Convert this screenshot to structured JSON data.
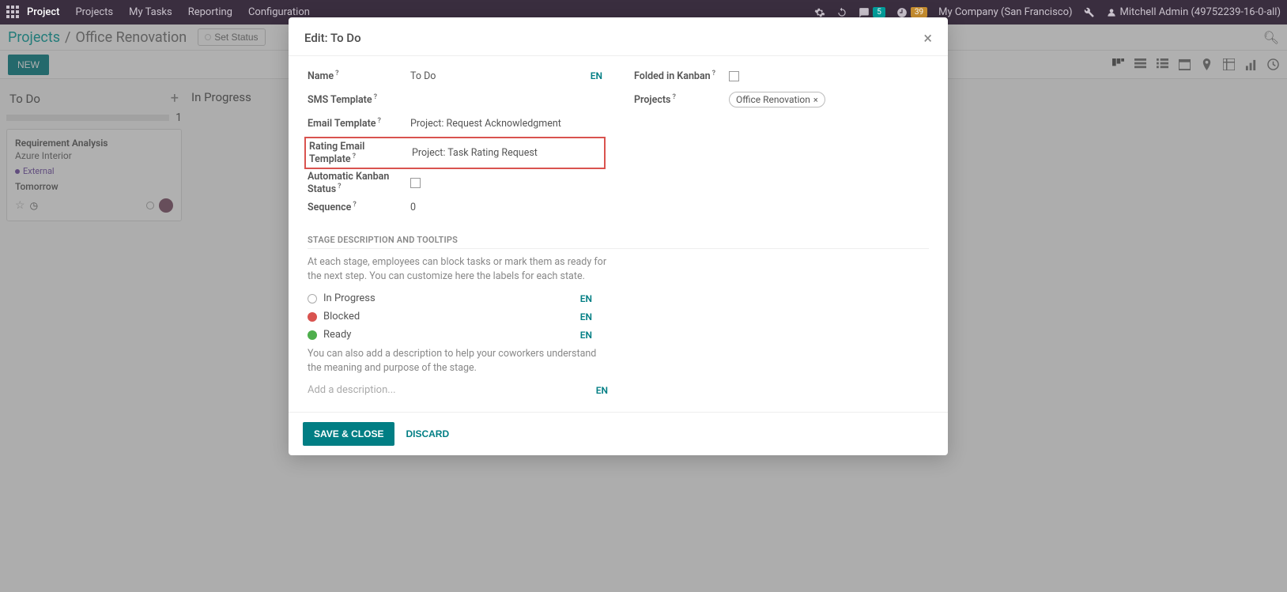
{
  "navbar": {
    "brand": "Project",
    "links": [
      "Projects",
      "My Tasks",
      "Reporting",
      "Configuration"
    ],
    "msg_count": "5",
    "clock_count": "39",
    "company": "My Company (San Francisco)",
    "user": "Mitchell Admin (49752239-16-0-all)"
  },
  "breadcrumb": {
    "root": "Projects",
    "current": "Office Renovation",
    "status_btn": "Set Status"
  },
  "toolbar": {
    "new": "NEW"
  },
  "kanban": {
    "cols": [
      {
        "title": "To Do",
        "count": "1"
      },
      {
        "title": "In Progress",
        "count": ""
      }
    ],
    "card": {
      "title": "Requirement Analysis",
      "sub": "Azure Interior",
      "tag": "External",
      "due": "Tomorrow"
    }
  },
  "modal": {
    "title": "Edit: To Do",
    "en": "EN",
    "fields": {
      "name_label": "Name",
      "name_val": "To Do",
      "sms_label": "SMS Template",
      "email_label": "Email Template",
      "email_val": "Project: Request Acknowledgment",
      "rating_label": "Rating Email Template",
      "rating_val": "Project: Task Rating Request",
      "auto_label": "Automatic Kanban Status",
      "seq_label": "Sequence",
      "seq_val": "0",
      "folded_label": "Folded in Kanban",
      "projects_label": "Projects",
      "project_tag": "Office Renovation"
    },
    "section": "STAGE DESCRIPTION AND TOOLTIPS",
    "help1": "At each stage, employees can block tasks or mark them as ready for the next step. You can customize here the labels for each state.",
    "states": {
      "in_progress": "In Progress",
      "blocked": "Blocked",
      "ready": "Ready"
    },
    "help2": "You can also add a description to help your coworkers understand the meaning and purpose of the stage.",
    "desc_ph": "Add a description...",
    "save": "SAVE & CLOSE",
    "discard": "DISCARD"
  }
}
